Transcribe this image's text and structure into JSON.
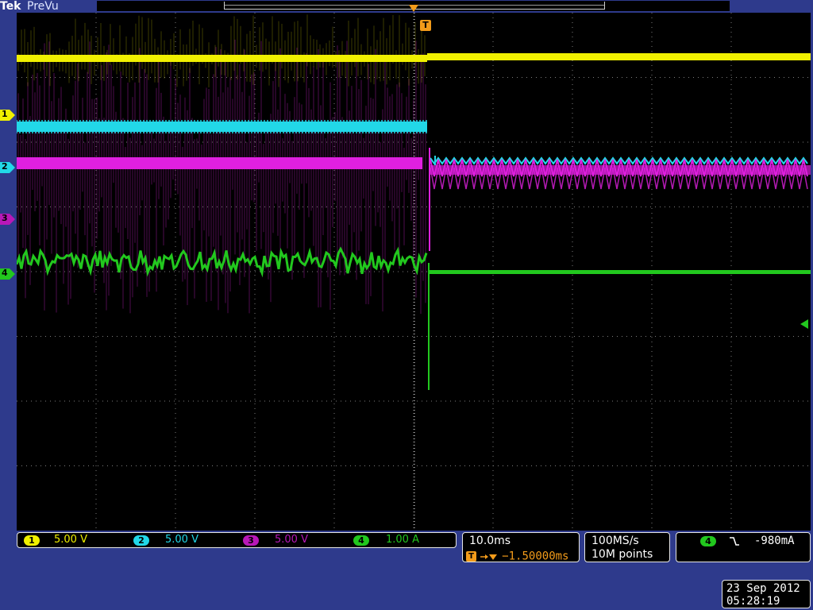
{
  "brand": {
    "logo": "Tek",
    "mode": "PreVu"
  },
  "colors": {
    "ch1": "#f0f000",
    "ch2": "#22d8e8",
    "ch3": "#e020e0",
    "ch4": "#22c81e",
    "trigger": "#f29b1a",
    "graticule": "#7d7d7d",
    "background": "#2e3a8c"
  },
  "trigger_marker": {
    "label": "T"
  },
  "channel_markers": [
    {
      "id": "1",
      "label": "1"
    },
    {
      "id": "2",
      "label": "2"
    },
    {
      "id": "3",
      "label": "3"
    },
    {
      "id": "4",
      "label": "4"
    }
  ],
  "channels": [
    {
      "id": "1",
      "num": "1",
      "scale": "5.00 V"
    },
    {
      "id": "2",
      "num": "2",
      "scale": "5.00 V"
    },
    {
      "id": "3",
      "num": "3",
      "scale": "5.00 V"
    },
    {
      "id": "4",
      "num": "4",
      "scale": "1.00 A"
    }
  ],
  "horizontal": {
    "scale": "10.0ms",
    "trigger_delay": "−1.50000ms"
  },
  "acquisition": {
    "sample_rate": "100MS/s",
    "record_length": "10M points"
  },
  "trigger": {
    "channel": "4",
    "slope_icon": "falling-edge-icon",
    "level": "-980mA"
  },
  "clock": {
    "date": "23 Sep  2012",
    "time": "05:28:19"
  }
}
